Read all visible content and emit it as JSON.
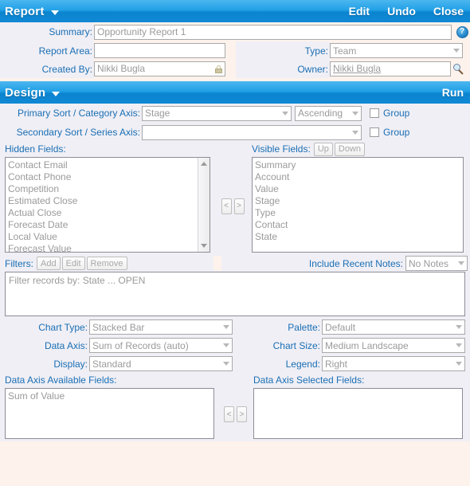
{
  "report_panel": {
    "title": "Report",
    "actions": [
      "Edit",
      "Undo",
      "Close"
    ],
    "fields": {
      "summary_label": "Summary:",
      "summary_value": "Opportunity Report 1",
      "report_area_label": "Report Area:",
      "report_area_value": "",
      "type_label": "Type:",
      "type_value": "Team",
      "created_by_label": "Created By:",
      "created_by_value": "Nikki Bugla",
      "owner_label": "Owner:",
      "owner_value": "Nikki Bugla"
    },
    "icons": {
      "help": "?",
      "lock": "lock-icon",
      "search": "search-icon"
    }
  },
  "design_panel": {
    "title": "Design",
    "run_label": "Run",
    "primary_sort_label": "Primary Sort / Category Axis:",
    "primary_sort_value": "Stage",
    "primary_direction_value": "Ascending",
    "primary_group_label": "Group",
    "secondary_sort_label": "Secondary Sort / Series Axis:",
    "secondary_sort_value": "",
    "secondary_group_label": "Group",
    "hidden_fields_label": "Hidden Fields:",
    "hidden_fields": [
      "Contact Email",
      "Contact Phone",
      "Competition",
      "Estimated Close",
      "Actual Close",
      "Forecast Date",
      "Local Value",
      "Forecast Value"
    ],
    "visible_fields_label": "Visible Fields:",
    "visible_up_label": "Up",
    "visible_down_label": "Down",
    "visible_fields": [
      "Summary",
      "Account",
      "Value",
      "Stage",
      "Type",
      "Contact",
      "State"
    ],
    "transfer_left": "<",
    "transfer_right": ">",
    "filters_label": "Filters:",
    "filters_add": "Add",
    "filters_edit": "Edit",
    "filters_remove": "Remove",
    "include_recent_notes_label": "Include Recent Notes:",
    "include_recent_notes_value": "No Notes",
    "filter_text": "Filter records by: State ... OPEN",
    "chart_type_label": "Chart Type:",
    "chart_type_value": "Stacked Bar",
    "palette_label": "Palette:",
    "palette_value": "Default",
    "data_axis_label": "Data Axis:",
    "data_axis_value": "Sum of Records (auto)",
    "chart_size_label": "Chart Size:",
    "chart_size_value": "Medium Landscape",
    "display_label": "Display:",
    "display_value": "Standard",
    "legend_label": "Legend:",
    "legend_value": "Right",
    "data_axis_available_label": "Data Axis Available Fields:",
    "data_axis_available": [
      "Sum of Value"
    ],
    "data_axis_selected_label": "Data Axis Selected Fields:",
    "data_axis_selected": []
  },
  "colors": {
    "header_blue": "#0b84d0",
    "label_blue": "#1a6fb5",
    "page_bg": "#fdf2ec",
    "row_bg": "#f0eff5"
  }
}
